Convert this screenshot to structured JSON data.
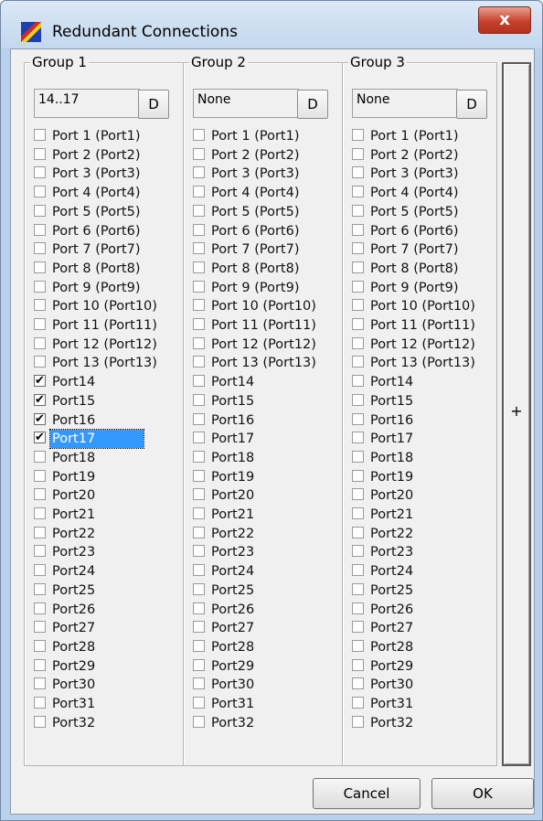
{
  "window": {
    "title": "Redundant Connections",
    "close_glyph": "x"
  },
  "groups": [
    {
      "title": "Group 1",
      "range": "14..17",
      "button": "D",
      "checked": [
        14,
        15,
        16,
        17
      ],
      "focused": 17
    },
    {
      "title": "Group 2",
      "range": "None",
      "button": "D",
      "checked": [],
      "focused": null
    },
    {
      "title": "Group 3",
      "range": "None",
      "button": "D",
      "checked": [],
      "focused": null
    }
  ],
  "ports": [
    "Port 1 (Port1)",
    "Port 2 (Port2)",
    "Port 3 (Port3)",
    "Port 4 (Port4)",
    "Port 5 (Port5)",
    "Port 6 (Port6)",
    "Port 7 (Port7)",
    "Port 8 (Port8)",
    "Port 9 (Port9)",
    "Port 10 (Port10)",
    "Port 11 (Port11)",
    "Port 12 (Port12)",
    "Port 13 (Port13)",
    "Port14",
    "Port15",
    "Port16",
    "Port17",
    "Port18",
    "Port19",
    "Port20",
    "Port21",
    "Port22",
    "Port23",
    "Port24",
    "Port25",
    "Port26",
    "Port27",
    "Port28",
    "Port29",
    "Port30",
    "Port31",
    "Port32"
  ],
  "add_button": "+",
  "buttons": {
    "cancel": "Cancel",
    "ok": "OK"
  },
  "colors": {
    "selection": "#3399ff",
    "title_bar": "#c3d7ee",
    "close": "#c7402c",
    "dialog_bg": "#f0f0f0"
  },
  "icons": {
    "app": "colored-stripes-icon",
    "check": "check-mark-icon"
  }
}
